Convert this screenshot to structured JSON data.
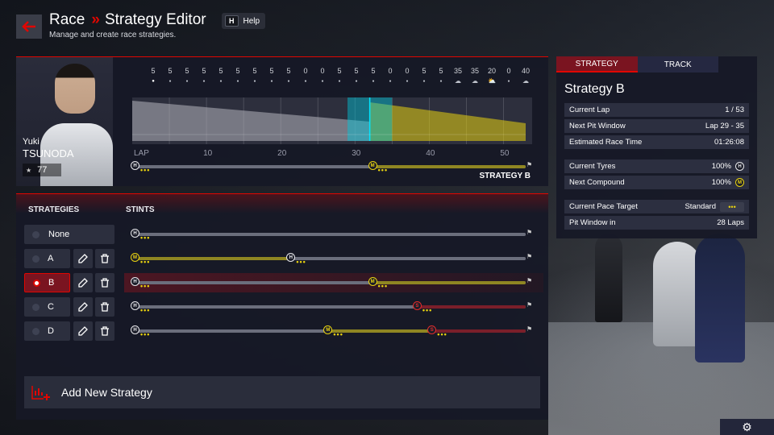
{
  "header": {
    "title_left": "Race",
    "title_sep": "»",
    "title_right": "Strategy Editor",
    "subtitle": "Manage and create race strategies.",
    "help_key": "H",
    "help_label": "Help"
  },
  "driver": {
    "first_name": "Yuki",
    "last_name": "TSUNODA",
    "rating": "77"
  },
  "weather": [
    {
      "pct": "5",
      "icon": "sun"
    },
    {
      "pct": "5",
      "icon": "dot"
    },
    {
      "pct": "5",
      "icon": "dot"
    },
    {
      "pct": "5",
      "icon": "dot"
    },
    {
      "pct": "5",
      "icon": "dot"
    },
    {
      "pct": "5",
      "icon": "dot"
    },
    {
      "pct": "5",
      "icon": "dot"
    },
    {
      "pct": "5",
      "icon": "dot"
    },
    {
      "pct": "5",
      "icon": "dot"
    },
    {
      "pct": "0",
      "icon": "dot"
    },
    {
      "pct": "0",
      "icon": "dot"
    },
    {
      "pct": "5",
      "icon": "dot"
    },
    {
      "pct": "5",
      "icon": "dot"
    },
    {
      "pct": "5",
      "icon": "dot"
    },
    {
      "pct": "0",
      "icon": "dot"
    },
    {
      "pct": "0",
      "icon": "dot"
    },
    {
      "pct": "5",
      "icon": "dot"
    },
    {
      "pct": "5",
      "icon": "dot"
    },
    {
      "pct": "35",
      "icon": "cloud"
    },
    {
      "pct": "35",
      "icon": "cloud"
    },
    {
      "pct": "20",
      "icon": "cloud-sun"
    },
    {
      "pct": "0",
      "icon": "dot"
    },
    {
      "pct": "40",
      "icon": "cloud"
    }
  ],
  "lap_axis": {
    "label": "LAP",
    "ticks": [
      "10",
      "20",
      "30",
      "40",
      "50"
    ],
    "total_laps": 53,
    "current_lap": 32
  },
  "selected_strip": {
    "label": "STRATEGY B",
    "stints": [
      {
        "compound": "H",
        "end": 32
      },
      {
        "compound": "M",
        "end": 53
      }
    ]
  },
  "strategies_panel": {
    "col_strategies": "STRATEGIES",
    "col_stints": "STINTS",
    "rows": [
      {
        "label": "None",
        "selected": false,
        "editable": false,
        "stints": [
          {
            "compound": "H",
            "end": 53
          }
        ]
      },
      {
        "label": "A",
        "selected": false,
        "editable": true,
        "stints": [
          {
            "compound": "M",
            "end": 21
          },
          {
            "compound": "H",
            "end": 53
          }
        ]
      },
      {
        "label": "B",
        "selected": true,
        "editable": true,
        "stints": [
          {
            "compound": "H",
            "end": 32
          },
          {
            "compound": "M",
            "end": 53
          }
        ]
      },
      {
        "label": "C",
        "selected": false,
        "editable": true,
        "stints": [
          {
            "compound": "H",
            "end": 38
          },
          {
            "compound": "S",
            "end": 53
          }
        ]
      },
      {
        "label": "D",
        "selected": false,
        "editable": true,
        "stints": [
          {
            "compound": "H",
            "end": 26
          },
          {
            "compound": "M",
            "end": 40
          },
          {
            "compound": "S",
            "end": 53
          }
        ]
      }
    ],
    "add_label": "Add New Strategy"
  },
  "tyre_colors": {
    "H": "#e8e8ec",
    "M": "#e8d210",
    "S": "#e22c2c"
  },
  "right_panel": {
    "tab_strategy": "STRATEGY",
    "tab_track": "TRACK",
    "title": "Strategy B",
    "info": [
      {
        "label": "Current Lap",
        "value": "1 / 53"
      },
      {
        "label": "Next Pit Window",
        "value": "Lap 29 - 35"
      },
      {
        "label": "Estimated Race Time",
        "value": "01:26:08"
      }
    ],
    "tyres": [
      {
        "label": "Current Tyres",
        "value": "100%",
        "compound": "H"
      },
      {
        "label": "Next Compound",
        "value": "100%",
        "compound": "M"
      }
    ],
    "pace": [
      {
        "label": "Current Pace Target",
        "value": "Standard"
      },
      {
        "label": "Pit Window in",
        "value": "28 Laps"
      }
    ]
  }
}
